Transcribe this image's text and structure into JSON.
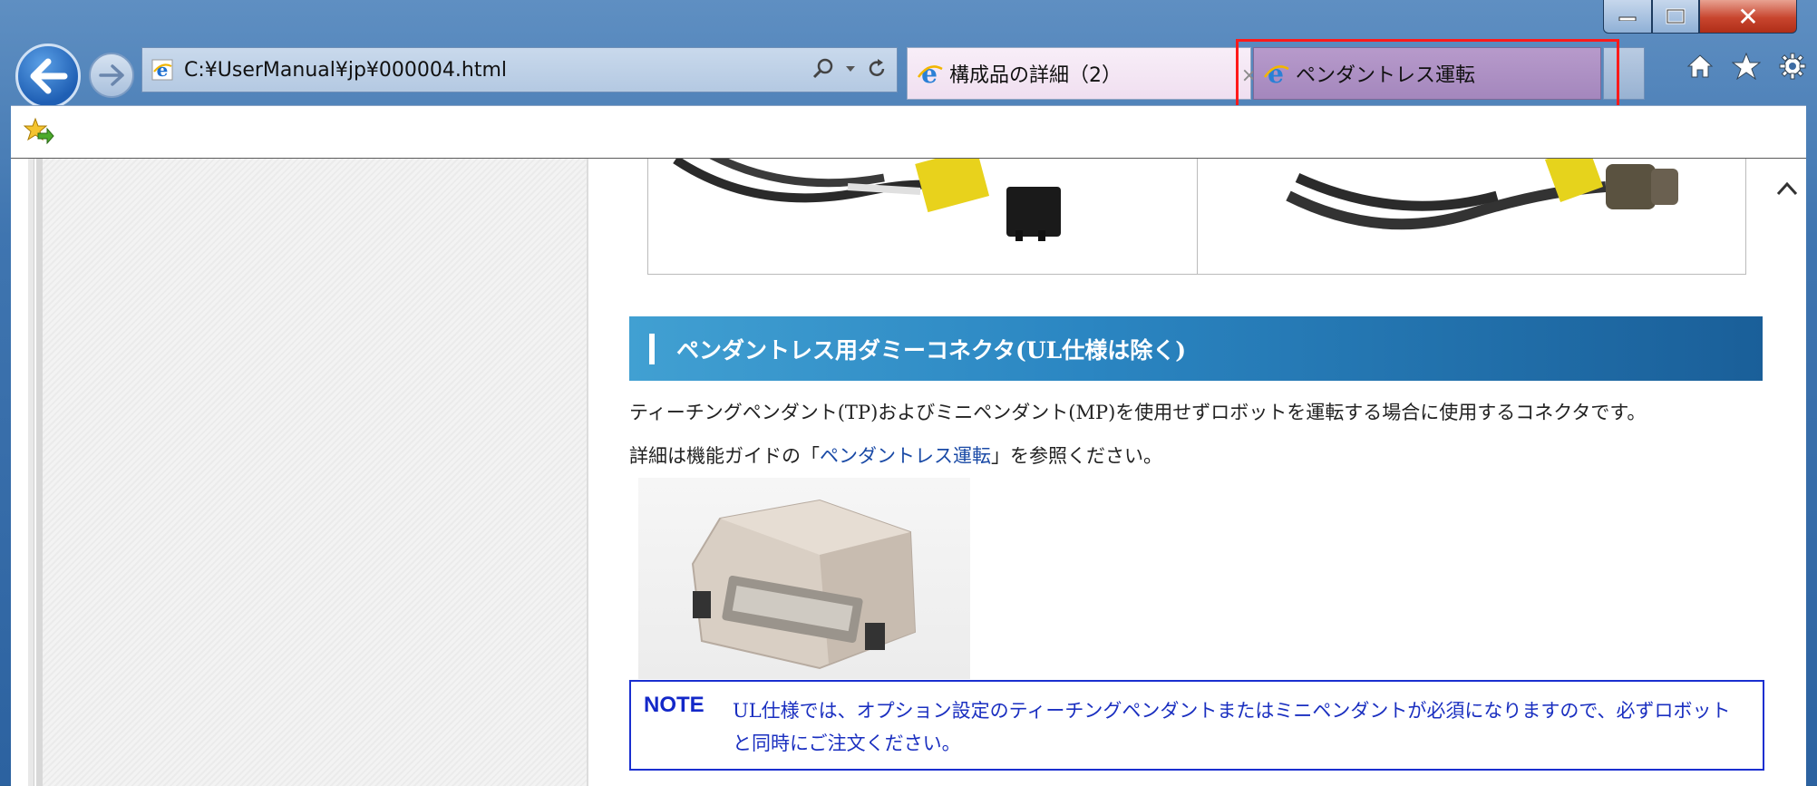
{
  "window": {
    "minimize_label": "‒",
    "maximize_label": "□",
    "close_label": "✕"
  },
  "address_bar": {
    "url": "C:¥UserManual¥jp¥000004.html"
  },
  "tabs": [
    {
      "label": "構成品の詳細（2）",
      "close_label": "×"
    },
    {
      "label": "ペンダントレス運転"
    }
  ],
  "toolbar_icons": [
    "home-icon",
    "star-icon",
    "gear-icon"
  ],
  "content": {
    "section_title": "ペンダントレス用ダミーコネクタ(UL仕様は除く)",
    "paragraph1": "ティーチングペンダント(TP)およびミニペンダント(MP)を使用せずロボットを運転する場合に使用するコネクタです。",
    "paragraph2_prefix": "詳細は機能ガイドの「",
    "paragraph2_link": "ペンダントレス運転",
    "paragraph2_suffix": "」を参照ください。",
    "note_label": "NOTE",
    "note_text": "UL仕様では、オプション設定のティーチングペンダントまたはミニペンダントが必須になりますので、必ずロボットと同時にご注文ください。"
  },
  "colors": {
    "section_bar_start": "#41a0d2",
    "section_bar_end": "#1a5f99",
    "note_border": "#1a2fd0",
    "highlight_border": "#ff1a1a",
    "active_tab": "#a487bd"
  }
}
